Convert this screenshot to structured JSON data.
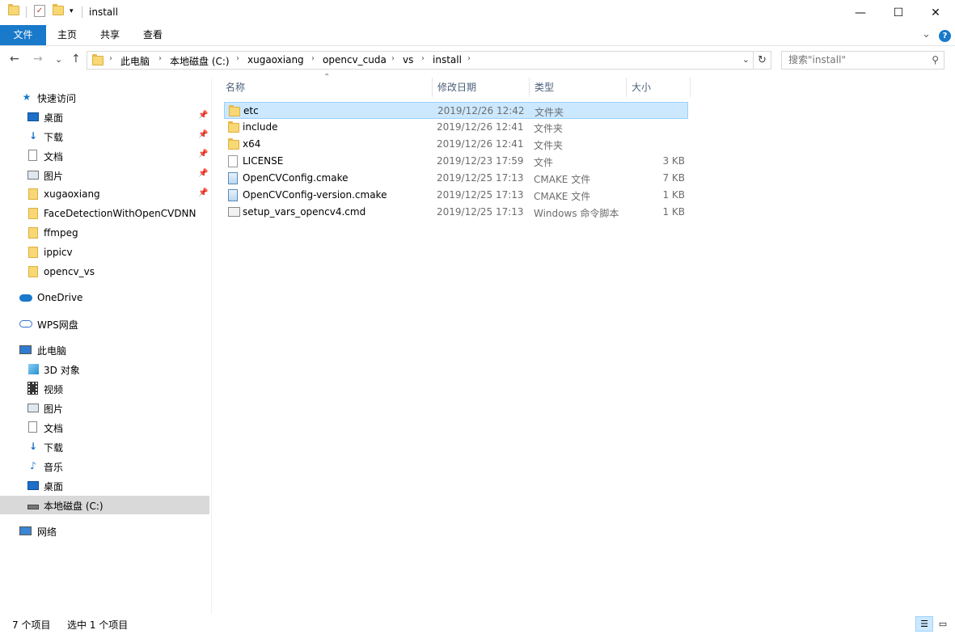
{
  "window": {
    "title": "install",
    "minimize_glyph": "—",
    "maximize_glyph": "☐",
    "close_glyph": "✕"
  },
  "ribbon": {
    "tabs": [
      "文件",
      "主页",
      "共享",
      "查看"
    ],
    "collapse_glyph": "⌄",
    "help_glyph": "?"
  },
  "nav": {
    "back": "←",
    "forward": "→",
    "recent": "⌄",
    "up": "↑"
  },
  "breadcrumb": [
    "此电脑",
    "本地磁盘 (C:)",
    "xugaoxiang",
    "opencv_cuda",
    "vs",
    "install"
  ],
  "search": {
    "placeholder": "搜索\"install\""
  },
  "sidebar": {
    "quick_access": "快速访问",
    "quick_items": [
      "桌面",
      "下载",
      "文档",
      "图片",
      "xugaoxiang",
      "FaceDetectionWithOpenCVDNN",
      "ffmpeg",
      "ippicv",
      "opencv_vs"
    ],
    "onedrive": "OneDrive",
    "wps": "WPS网盘",
    "this_pc": "此电脑",
    "pc_items": [
      "3D 对象",
      "视频",
      "图片",
      "文档",
      "下载",
      "音乐",
      "桌面",
      "本地磁盘 (C:)"
    ],
    "network": "网络"
  },
  "columns": {
    "name": "名称",
    "modified": "修改日期",
    "type": "类型",
    "size": "大小"
  },
  "files": [
    {
      "name": "etc",
      "date": "2019/12/26 12:42",
      "type": "文件夹",
      "size": "",
      "icon": "folder-icon"
    },
    {
      "name": "include",
      "date": "2019/12/26 12:41",
      "type": "文件夹",
      "size": "",
      "icon": "folder-icon"
    },
    {
      "name": "x64",
      "date": "2019/12/26 12:41",
      "type": "文件夹",
      "size": "",
      "icon": "folder-icon"
    },
    {
      "name": "LICENSE",
      "date": "2019/12/23 17:59",
      "type": "文件",
      "size": "3 KB",
      "icon": "file-icon"
    },
    {
      "name": "OpenCVConfig.cmake",
      "date": "2019/12/25 17:13",
      "type": "CMAKE 文件",
      "size": "7 KB",
      "icon": "cmake-file-icon"
    },
    {
      "name": "OpenCVConfig-version.cmake",
      "date": "2019/12/25 17:13",
      "type": "CMAKE 文件",
      "size": "1 KB",
      "icon": "cmake-file-icon"
    },
    {
      "name": "setup_vars_opencv4.cmd",
      "date": "2019/12/25 17:13",
      "type": "Windows 命令脚本",
      "size": "1 KB",
      "icon": "cmd-file-icon"
    }
  ],
  "status": {
    "count": "7 个项目",
    "selected": "选中 1 个项目"
  },
  "colors": {
    "accent": "#1979ca",
    "selection": "#cce8ff",
    "selection_border": "#99d1ff",
    "folder": "#f8d775"
  }
}
